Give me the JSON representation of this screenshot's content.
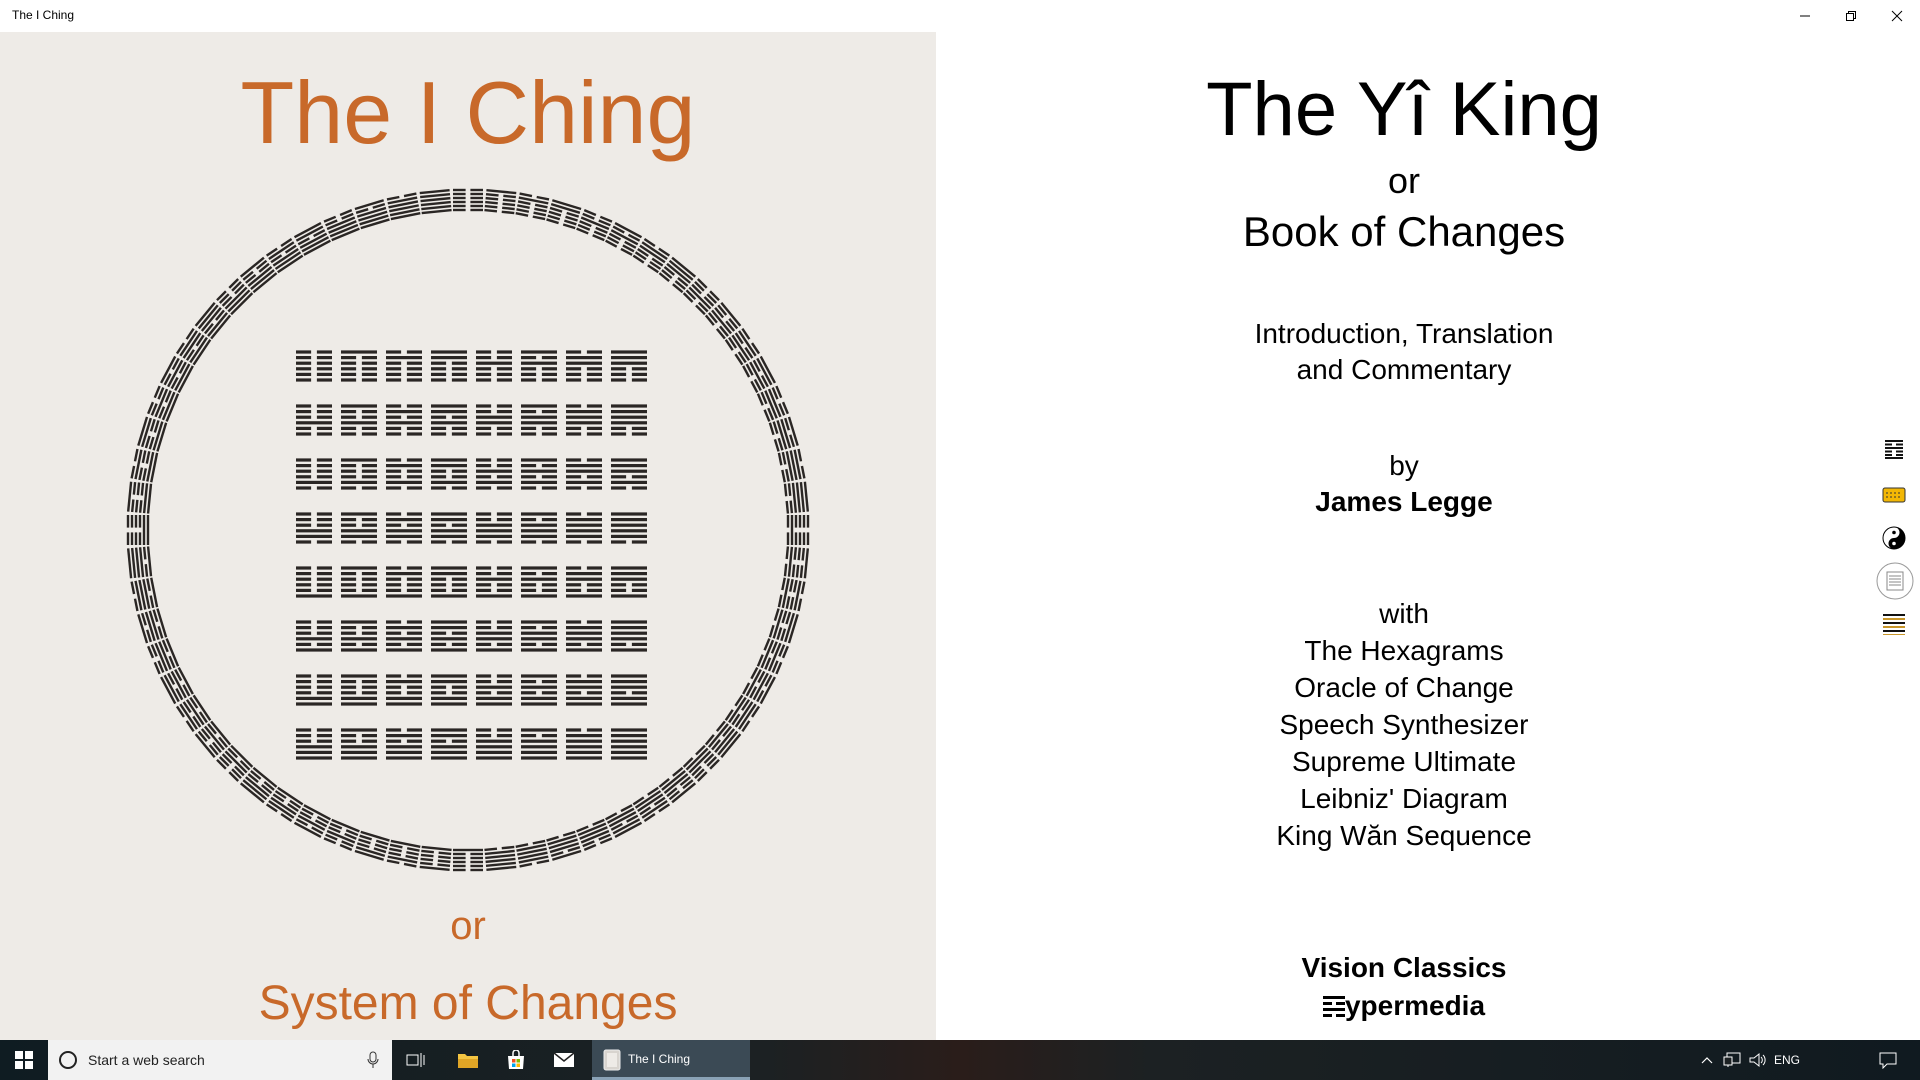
{
  "window": {
    "title": "The I Ching"
  },
  "cover": {
    "title": "The I Ching",
    "or": "or",
    "subtitle": "System of Changes",
    "accent_color": "#c8692a"
  },
  "titlepage": {
    "title": "The Yî King",
    "or": "or",
    "subtitle": "Book of Changes",
    "intro_line1": "Introduction, Translation",
    "intro_line2": "and Commentary",
    "by": "by",
    "author": "James Legge",
    "with": "with",
    "features": [
      "The Hexagrams",
      "Oracle of Change",
      "Speech Synthesizer",
      "Supreme Ultimate",
      "Leibniz' Diagram",
      "King Wăn Sequence"
    ],
    "publisher_line1": "Vision Classics",
    "publisher_line2": "ypermedia"
  },
  "side_nav": [
    {
      "icon": "hexagram-icon"
    },
    {
      "icon": "ticket-icon"
    },
    {
      "icon": "yin-yang-icon"
    },
    {
      "icon": "diagram-icon"
    },
    {
      "icon": "sequence-icon"
    }
  ],
  "taskbar": {
    "search_placeholder": "Start a web search",
    "active_app": "The I Ching",
    "language": "ENG"
  }
}
